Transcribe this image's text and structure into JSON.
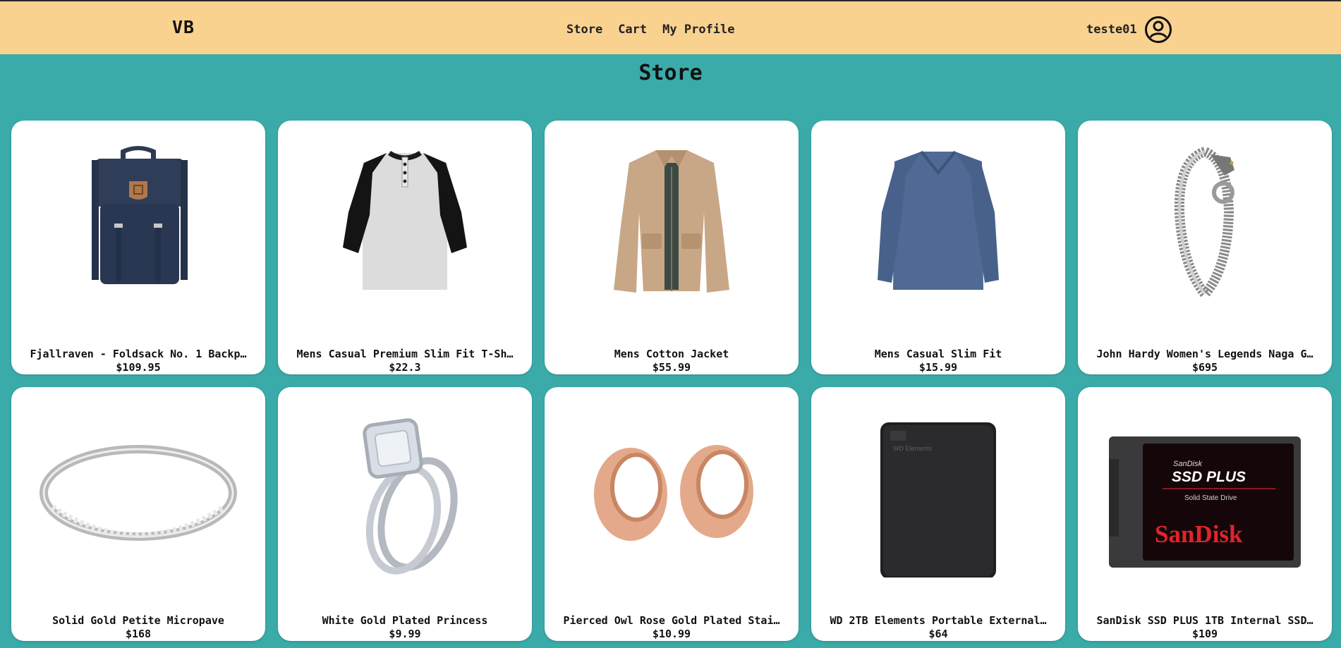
{
  "header": {
    "logo": "VB",
    "nav": [
      "Store",
      "Cart",
      "My Profile"
    ],
    "username": "teste01",
    "user_icon": "user-circle-icon"
  },
  "page": {
    "title": "Store"
  },
  "products": [
    {
      "name": "Fjallraven - Foldsack No. 1 Backp…",
      "price": "$109.95",
      "image": "backpack"
    },
    {
      "name": "Mens Casual Premium Slim Fit T-Sh…",
      "price": "$22.3",
      "image": "raglan-tshirt"
    },
    {
      "name": "Mens Cotton Jacket",
      "price": "$55.99",
      "image": "jacket"
    },
    {
      "name": "Mens Casual Slim Fit",
      "price": "$15.99",
      "image": "long-sleeve-shirt"
    },
    {
      "name": "John Hardy Women's Legends Naga G…",
      "price": "$695",
      "image": "dragon-bracelet"
    },
    {
      "name": "Solid Gold Petite Micropave",
      "price": "$168",
      "image": "band-ring"
    },
    {
      "name": "White Gold Plated Princess",
      "price": "$9.99",
      "image": "engagement-ring"
    },
    {
      "name": "Pierced Owl Rose Gold Plated Stai…",
      "price": "$10.99",
      "image": "ear-tunnels"
    },
    {
      "name": "WD 2TB Elements Portable External…",
      "price": "$64",
      "image": "external-hdd"
    },
    {
      "name": "SanDisk SSD PLUS 1TB Internal SSD…",
      "price": "$109",
      "image": "ssd"
    }
  ],
  "image_text": {
    "wd_label": "WD Elements",
    "ssd_brand_small": "SanDisk",
    "ssd_model": "SSD PLUS",
    "ssd_sub": "Solid State Drive",
    "ssd_brand": "SanDisk"
  },
  "colors": {
    "background": "#3aaba9",
    "header": "#f9d290",
    "card": "#ffffff"
  }
}
